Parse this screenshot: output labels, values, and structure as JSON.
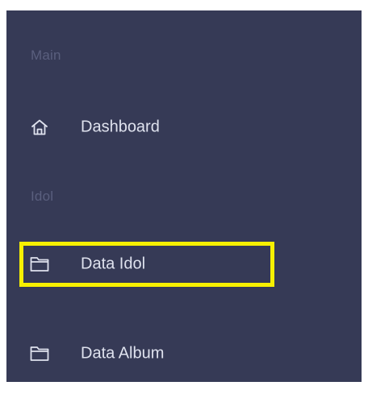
{
  "sidebar": {
    "sections": [
      {
        "title": "Main",
        "items": [
          {
            "label": "Dashboard",
            "icon": "home-icon"
          }
        ]
      },
      {
        "title": "Idol",
        "items": [
          {
            "label": "Data Idol",
            "icon": "folder-icon",
            "highlighted": true
          },
          {
            "label": "Data Album",
            "icon": "folder-icon"
          }
        ]
      }
    ]
  },
  "colors": {
    "sidebar_background": "#363a56",
    "section_title": "#5a5f7e",
    "item_text": "#dfe2ee",
    "highlight_border": "#f7f000"
  }
}
